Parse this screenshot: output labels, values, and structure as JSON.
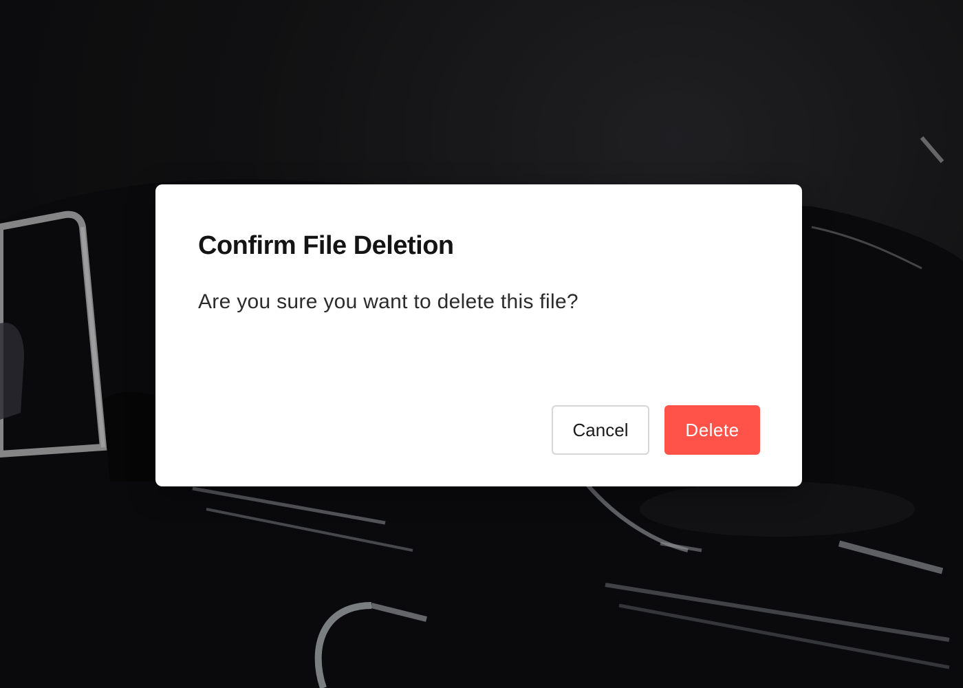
{
  "dialog": {
    "title": "Confirm File Deletion",
    "message": "Are you sure you want to delete this file?",
    "cancel_label": "Cancel",
    "delete_label": "Delete"
  },
  "colors": {
    "delete_button": "#ff5249",
    "dialog_background": "#ffffff",
    "backdrop": "#161618"
  }
}
